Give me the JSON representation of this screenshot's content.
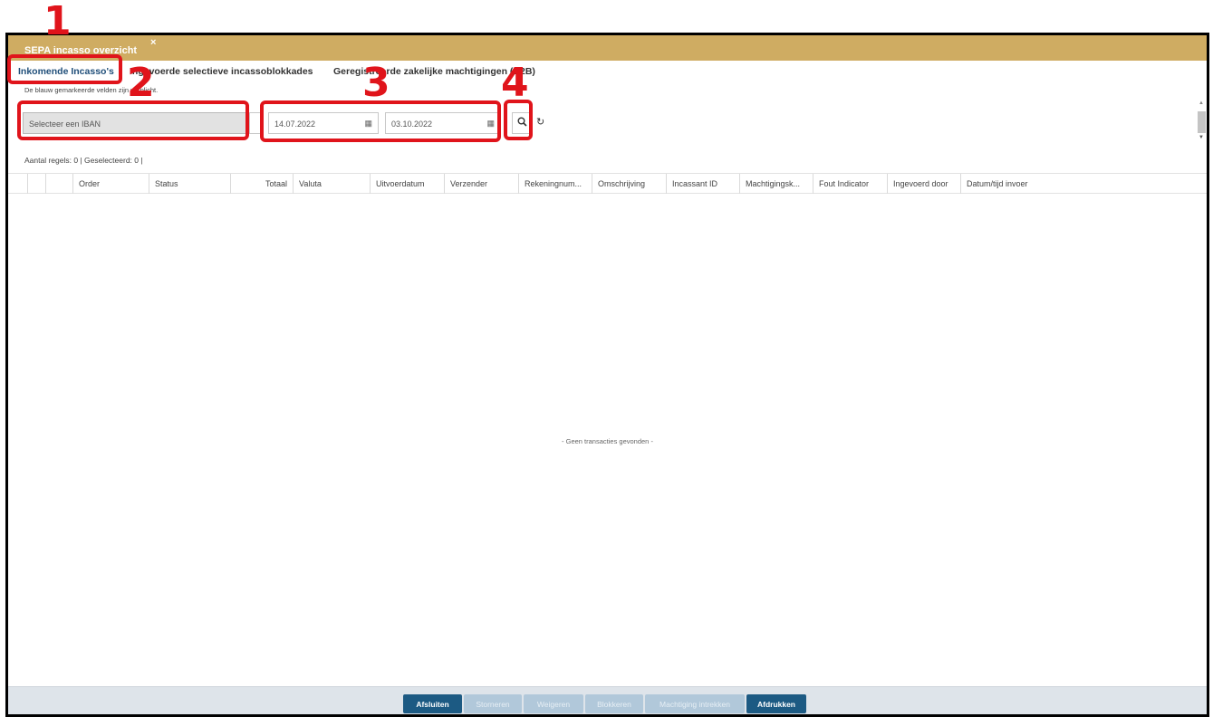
{
  "window": {
    "tab_title": "SEPA incasso overzicht",
    "close_glyph": "×"
  },
  "subtabs": [
    {
      "label": "Inkomende Incasso's"
    },
    {
      "label": "Ingevoerde selectieve incassoblokkades"
    },
    {
      "label": "Geregistreerde zakelijke machtigingen (B2B)"
    }
  ],
  "required_note": "De blauw gemarkeerde velden zijn verplicht.",
  "filters": {
    "iban_placeholder": "Selecteer een IBAN",
    "date_from": "14.07.2022",
    "date_to": "03.10.2022",
    "calendar_icon": "calendar-icon",
    "search_icon": "search-icon",
    "reset_icon": "reset-icon"
  },
  "count_line": "Aantal regels: 0 | Geselecteerd: 0 |",
  "columns": [
    "Order",
    "Status",
    "Totaal",
    "Valuta",
    "Uitvoerdatum",
    "Verzender",
    "Rekeningnum...",
    "Omschrijving",
    "Incassant ID",
    "Machtigingsk...",
    "Fout Indicator",
    "Ingevoerd door",
    "Datum/tijd invoer"
  ],
  "empty_message": "- Geen transacties gevonden -",
  "footer_buttons": [
    {
      "label": "Afsluiten",
      "state": "enabled"
    },
    {
      "label": "Storneren",
      "state": "disabled"
    },
    {
      "label": "Weigeren",
      "state": "disabled"
    },
    {
      "label": "Blokkeren",
      "state": "disabled"
    },
    {
      "label": "Machtiging intrekken",
      "state": "disabled"
    },
    {
      "label": "Afdrukken",
      "state": "enabled"
    }
  ],
  "annotations": [
    "1",
    "2",
    "3",
    "4"
  ],
  "colors": {
    "accent": "#cfac62",
    "primary_button": "#1c5a83",
    "annotation": "#e0141b"
  }
}
